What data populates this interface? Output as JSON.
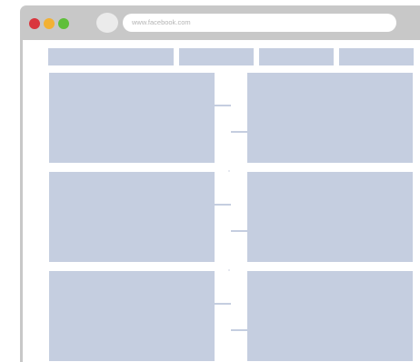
{
  "browser": {
    "url": "www.facebook.com",
    "controls": [
      "close",
      "minimize",
      "zoom"
    ],
    "colors": {
      "frame": "#c8c8c8",
      "close": "#d9363e",
      "minimize": "#f2b134",
      "zoom": "#5fbf3a",
      "placeholder": "#c5cee0"
    }
  },
  "page": {
    "nav_items": 4,
    "timeline_rows": 3
  }
}
